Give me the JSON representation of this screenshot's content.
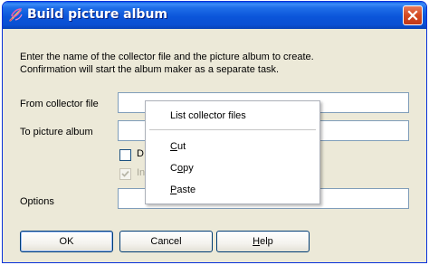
{
  "window": {
    "title": "Build picture album",
    "title_icon": "brush-icon",
    "close_icon": "close-icon"
  },
  "intro": {
    "line1": "Enter the name of the collector file and the picture album to create.",
    "line2": "Confirmation will start the album maker as a separate task."
  },
  "form": {
    "from_label": "From collector file",
    "from_value": "",
    "to_label": "To picture album",
    "to_value": "",
    "checkbox1_label": "D",
    "checkbox1_checked": false,
    "checkbox2_label": "In",
    "checkbox2_checked": true,
    "checkbox2_disabled": true,
    "options_label": "Options",
    "options_value": ""
  },
  "buttons": {
    "ok": "OK",
    "cancel": "Cancel",
    "help_accel": "H",
    "help_rest": "elp"
  },
  "context_menu": {
    "items": [
      {
        "pre": "List collector files",
        "accel": "",
        "post": ""
      },
      {
        "pre": "",
        "accel": "C",
        "post": "ut"
      },
      {
        "pre": "C",
        "accel": "o",
        "post": "py"
      },
      {
        "pre": "",
        "accel": "P",
        "post": "aste"
      }
    ]
  },
  "colors": {
    "titlebar": "#0b55da",
    "dialog_bg": "#ece9d8",
    "close_button": "#d44a21",
    "button_border": "#003c74",
    "field_border": "#7f9db9"
  }
}
